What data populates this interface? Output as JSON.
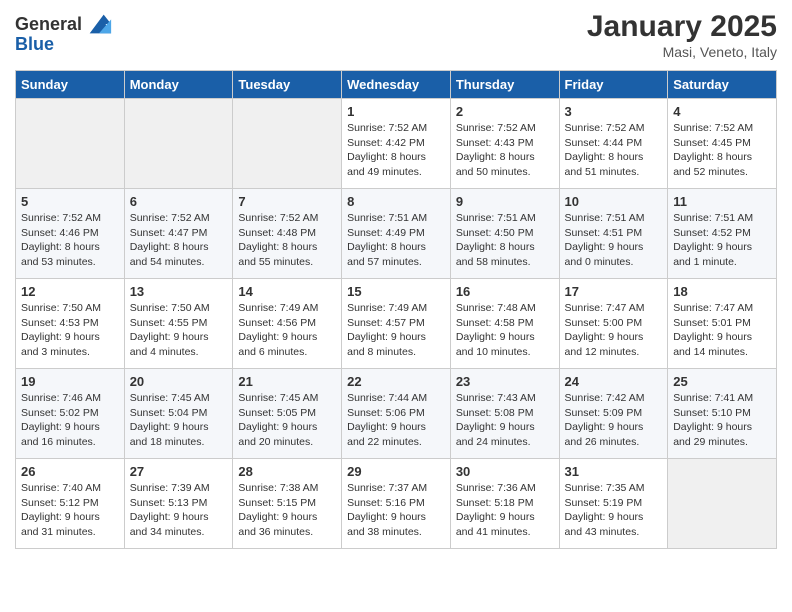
{
  "logo": {
    "general": "General",
    "blue": "Blue"
  },
  "title": "January 2025",
  "location": "Masi, Veneto, Italy",
  "weekdays": [
    "Sunday",
    "Monday",
    "Tuesday",
    "Wednesday",
    "Thursday",
    "Friday",
    "Saturday"
  ],
  "weeks": [
    [
      {
        "day": "",
        "sunrise": "",
        "sunset": "",
        "daylight": ""
      },
      {
        "day": "",
        "sunrise": "",
        "sunset": "",
        "daylight": ""
      },
      {
        "day": "",
        "sunrise": "",
        "sunset": "",
        "daylight": ""
      },
      {
        "day": "1",
        "sunrise": "Sunrise: 7:52 AM",
        "sunset": "Sunset: 4:42 PM",
        "daylight": "Daylight: 8 hours and 49 minutes."
      },
      {
        "day": "2",
        "sunrise": "Sunrise: 7:52 AM",
        "sunset": "Sunset: 4:43 PM",
        "daylight": "Daylight: 8 hours and 50 minutes."
      },
      {
        "day": "3",
        "sunrise": "Sunrise: 7:52 AM",
        "sunset": "Sunset: 4:44 PM",
        "daylight": "Daylight: 8 hours and 51 minutes."
      },
      {
        "day": "4",
        "sunrise": "Sunrise: 7:52 AM",
        "sunset": "Sunset: 4:45 PM",
        "daylight": "Daylight: 8 hours and 52 minutes."
      }
    ],
    [
      {
        "day": "5",
        "sunrise": "Sunrise: 7:52 AM",
        "sunset": "Sunset: 4:46 PM",
        "daylight": "Daylight: 8 hours and 53 minutes."
      },
      {
        "day": "6",
        "sunrise": "Sunrise: 7:52 AM",
        "sunset": "Sunset: 4:47 PM",
        "daylight": "Daylight: 8 hours and 54 minutes."
      },
      {
        "day": "7",
        "sunrise": "Sunrise: 7:52 AM",
        "sunset": "Sunset: 4:48 PM",
        "daylight": "Daylight: 8 hours and 55 minutes."
      },
      {
        "day": "8",
        "sunrise": "Sunrise: 7:51 AM",
        "sunset": "Sunset: 4:49 PM",
        "daylight": "Daylight: 8 hours and 57 minutes."
      },
      {
        "day": "9",
        "sunrise": "Sunrise: 7:51 AM",
        "sunset": "Sunset: 4:50 PM",
        "daylight": "Daylight: 8 hours and 58 minutes."
      },
      {
        "day": "10",
        "sunrise": "Sunrise: 7:51 AM",
        "sunset": "Sunset: 4:51 PM",
        "daylight": "Daylight: 9 hours and 0 minutes."
      },
      {
        "day": "11",
        "sunrise": "Sunrise: 7:51 AM",
        "sunset": "Sunset: 4:52 PM",
        "daylight": "Daylight: 9 hours and 1 minute."
      }
    ],
    [
      {
        "day": "12",
        "sunrise": "Sunrise: 7:50 AM",
        "sunset": "Sunset: 4:53 PM",
        "daylight": "Daylight: 9 hours and 3 minutes."
      },
      {
        "day": "13",
        "sunrise": "Sunrise: 7:50 AM",
        "sunset": "Sunset: 4:55 PM",
        "daylight": "Daylight: 9 hours and 4 minutes."
      },
      {
        "day": "14",
        "sunrise": "Sunrise: 7:49 AM",
        "sunset": "Sunset: 4:56 PM",
        "daylight": "Daylight: 9 hours and 6 minutes."
      },
      {
        "day": "15",
        "sunrise": "Sunrise: 7:49 AM",
        "sunset": "Sunset: 4:57 PM",
        "daylight": "Daylight: 9 hours and 8 minutes."
      },
      {
        "day": "16",
        "sunrise": "Sunrise: 7:48 AM",
        "sunset": "Sunset: 4:58 PM",
        "daylight": "Daylight: 9 hours and 10 minutes."
      },
      {
        "day": "17",
        "sunrise": "Sunrise: 7:47 AM",
        "sunset": "Sunset: 5:00 PM",
        "daylight": "Daylight: 9 hours and 12 minutes."
      },
      {
        "day": "18",
        "sunrise": "Sunrise: 7:47 AM",
        "sunset": "Sunset: 5:01 PM",
        "daylight": "Daylight: 9 hours and 14 minutes."
      }
    ],
    [
      {
        "day": "19",
        "sunrise": "Sunrise: 7:46 AM",
        "sunset": "Sunset: 5:02 PM",
        "daylight": "Daylight: 9 hours and 16 minutes."
      },
      {
        "day": "20",
        "sunrise": "Sunrise: 7:45 AM",
        "sunset": "Sunset: 5:04 PM",
        "daylight": "Daylight: 9 hours and 18 minutes."
      },
      {
        "day": "21",
        "sunrise": "Sunrise: 7:45 AM",
        "sunset": "Sunset: 5:05 PM",
        "daylight": "Daylight: 9 hours and 20 minutes."
      },
      {
        "day": "22",
        "sunrise": "Sunrise: 7:44 AM",
        "sunset": "Sunset: 5:06 PM",
        "daylight": "Daylight: 9 hours and 22 minutes."
      },
      {
        "day": "23",
        "sunrise": "Sunrise: 7:43 AM",
        "sunset": "Sunset: 5:08 PM",
        "daylight": "Daylight: 9 hours and 24 minutes."
      },
      {
        "day": "24",
        "sunrise": "Sunrise: 7:42 AM",
        "sunset": "Sunset: 5:09 PM",
        "daylight": "Daylight: 9 hours and 26 minutes."
      },
      {
        "day": "25",
        "sunrise": "Sunrise: 7:41 AM",
        "sunset": "Sunset: 5:10 PM",
        "daylight": "Daylight: 9 hours and 29 minutes."
      }
    ],
    [
      {
        "day": "26",
        "sunrise": "Sunrise: 7:40 AM",
        "sunset": "Sunset: 5:12 PM",
        "daylight": "Daylight: 9 hours and 31 minutes."
      },
      {
        "day": "27",
        "sunrise": "Sunrise: 7:39 AM",
        "sunset": "Sunset: 5:13 PM",
        "daylight": "Daylight: 9 hours and 34 minutes."
      },
      {
        "day": "28",
        "sunrise": "Sunrise: 7:38 AM",
        "sunset": "Sunset: 5:15 PM",
        "daylight": "Daylight: 9 hours and 36 minutes."
      },
      {
        "day": "29",
        "sunrise": "Sunrise: 7:37 AM",
        "sunset": "Sunset: 5:16 PM",
        "daylight": "Daylight: 9 hours and 38 minutes."
      },
      {
        "day": "30",
        "sunrise": "Sunrise: 7:36 AM",
        "sunset": "Sunset: 5:18 PM",
        "daylight": "Daylight: 9 hours and 41 minutes."
      },
      {
        "day": "31",
        "sunrise": "Sunrise: 7:35 AM",
        "sunset": "Sunset: 5:19 PM",
        "daylight": "Daylight: 9 hours and 43 minutes."
      },
      {
        "day": "",
        "sunrise": "",
        "sunset": "",
        "daylight": ""
      }
    ]
  ]
}
